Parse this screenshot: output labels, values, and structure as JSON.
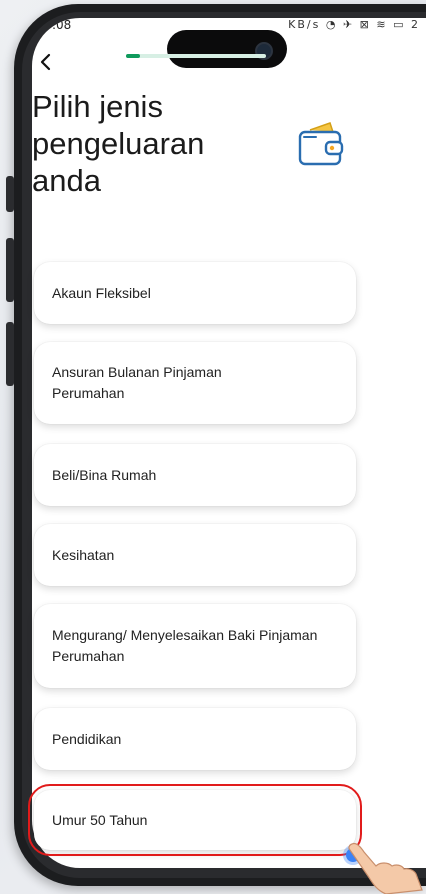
{
  "status_bar": {
    "time": ":08",
    "icons": "KB/s ◔ ✈ ⊠ ≋ ▭ 2"
  },
  "header": {
    "back_icon": "chevron-left-icon",
    "progress": 0.1
  },
  "title": "Pilih jenis pengeluaran anda",
  "wallet_icon": "wallet-icon",
  "options": [
    "Akaun Fleksibel",
    "Ansuran Bulanan Pinjaman Perumahan",
    "Beli/Bina Rumah",
    "Kesihatan",
    "Mengurang/ Menyelesaikan Baki Pinjaman Perumahan",
    "Pendidikan",
    "Umur 50 Tahun"
  ],
  "selected_option": "Umur 50 Tahun",
  "colors": {
    "accent": "#0f9a5c",
    "progress_track": "#d7efe4",
    "highlight": "#e11b1b",
    "tap_dot": "#3b82f6",
    "wallet": "#2a6db0"
  }
}
